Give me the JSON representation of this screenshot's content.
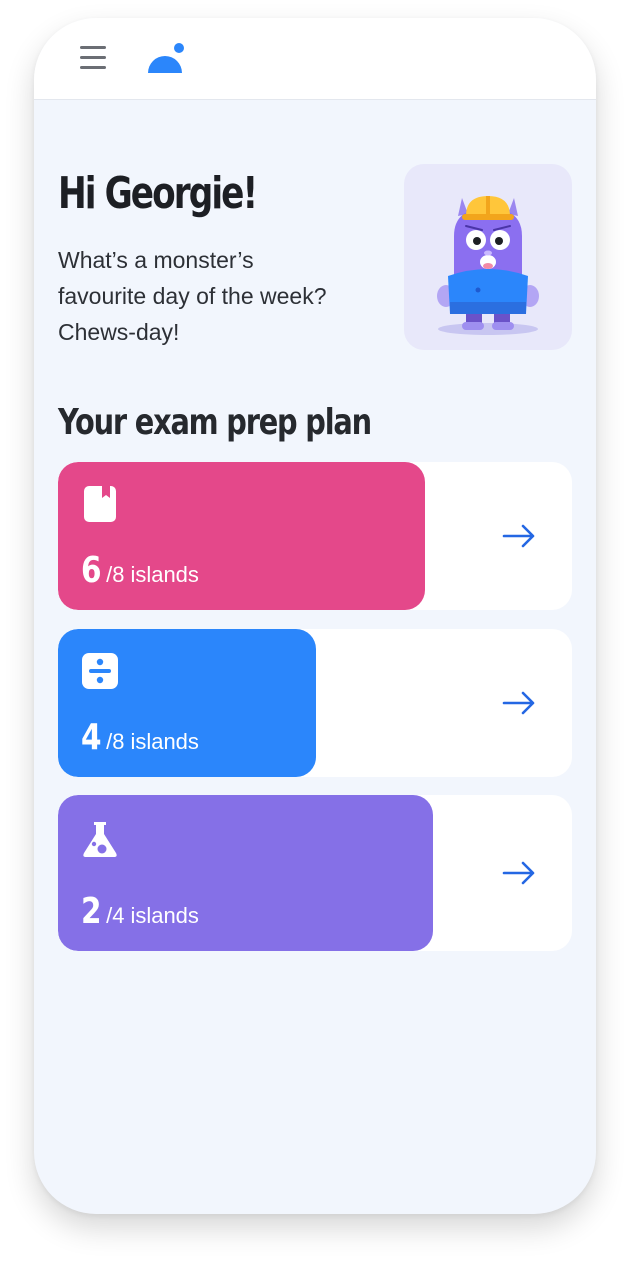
{
  "header": {
    "menu_icon": "hamburger-menu-icon",
    "logo_icon": "app-logo-icon"
  },
  "greeting": {
    "title": "Hi Georgie!",
    "joke_lines": [
      "What’s a monster’s",
      "favourite day of the week?",
      "Chews-day!"
    ],
    "mascot": "purple-monster-with-hard-hat"
  },
  "exam_plan": {
    "title": "Your exam prep plan",
    "unit_label": "islands",
    "items": [
      {
        "subject_icon": "book-icon",
        "completed": "6",
        "total": "8",
        "progress": 0.715,
        "color": "#e4488a"
      },
      {
        "subject_icon": "divide-icon",
        "completed": "4",
        "total": "8",
        "progress": 0.5,
        "color": "#2b86fb"
      },
      {
        "subject_icon": "science-flask-icon",
        "completed": "2",
        "total": "4",
        "progress": 0.73,
        "color": "#8570e7"
      }
    ],
    "arrow_color": "#2467e3"
  },
  "colors": {
    "background": "#f2f6fd",
    "brand_blue": "#2b86fb"
  }
}
